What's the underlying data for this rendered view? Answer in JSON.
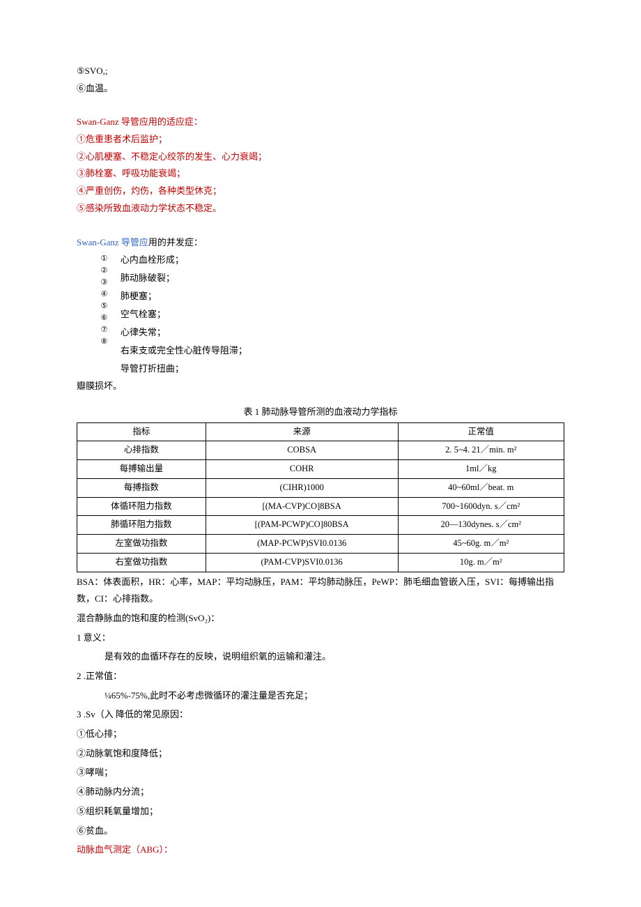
{
  "top": {
    "l1": "⑤SVO,;",
    "l2": "⑥血温。"
  },
  "indications": {
    "title": "Swan-Ganz 导管应用的适应症：",
    "i1": "①危重患者术后监护；",
    "i2": "②心肌梗塞、不稳定心绞䇣的发生、心力衰竭；",
    "i3": "③肺栓塞、呼吸功能衰竭；",
    "i4": "④严重创伤，灼伤，各种类型休克；",
    "i5": "⑤感染所致血液动力学状态不稳定。"
  },
  "complications": {
    "title_a": "Swan-Ganz 导管应",
    "title_b": "用的并发症：",
    "nums": "①②③④⑤⑥⑦⑧",
    "c1": "心内血栓形成；",
    "c2": "肺动脉破裂；",
    "c3": "肺梗塞；",
    "c4": "空气栓塞；",
    "c5": "心律失常；",
    "c6": "右束支或完全性心脏传导阻滞；",
    "c7": "导管打折扭曲；",
    "c8": "瓣膜损坏。"
  },
  "table": {
    "title": "表 1 肺动脉导管所测的血液动力学指标",
    "h1": "指标",
    "h2": "来源",
    "h3": "正常值",
    "rows": [
      {
        "a": "心排指数",
        "b": "COBSA",
        "c": "2. 5~4. 21／min. m²"
      },
      {
        "a": "每搏输出量",
        "b": "COHR",
        "c": "1ml／kg"
      },
      {
        "a": "每搏指数",
        "b": "(CIHR)1000",
        "c": "40~60ml／beat. m"
      },
      {
        "a": "体循环阻力指数",
        "b": "[(MA-CVP)CO]8BSA",
        "c": "700~1600dyn. s／cm²"
      },
      {
        "a": "肺循环阻力指数",
        "b": "[(PAM-PCWP)CO]80BSA",
        "c": "20—130dynes. s／cm²"
      },
      {
        "a": "左室做功指数",
        "b": "(MAP-PCWP)SVI0.0136",
        "c": "45~60g. m／m²"
      },
      {
        "a": "右室做功指数",
        "b": "(PAM-CVP)SVI0.0136",
        "c": "10g. m／m²"
      }
    ],
    "abbr": "BSA：体表面积，HR：心率，MAP：平均动脉压，PAM：平均肺动脉压，PeWP：肺毛细血管嵌入压，SVI：每搏输出指数，CI：心排指数。"
  },
  "svo": {
    "title": "混合静脉血的饱和度的检测(SvO₂)：",
    "s1a": "1 意义：",
    "s1b": "是有效的血循环存在的反映，说明组织氧的运输和灌注。",
    "s2a": "2  .正常值：",
    "s2b": "¼65%-75%,此时不必考虑微循环的灌注量是否充足；",
    "s3a": "3  .Sv（入 降低的常见原因：",
    "r1": "①低心排；",
    "r2": "②动脉氧饱和度降低；",
    "r3": "③哮喘；",
    "r4": "④肺动脉内分流；",
    "r5": "⑤组织耗氧量增加；",
    "r6": "⑥贫血。"
  },
  "abg": "动脉血气测定（ABG）："
}
